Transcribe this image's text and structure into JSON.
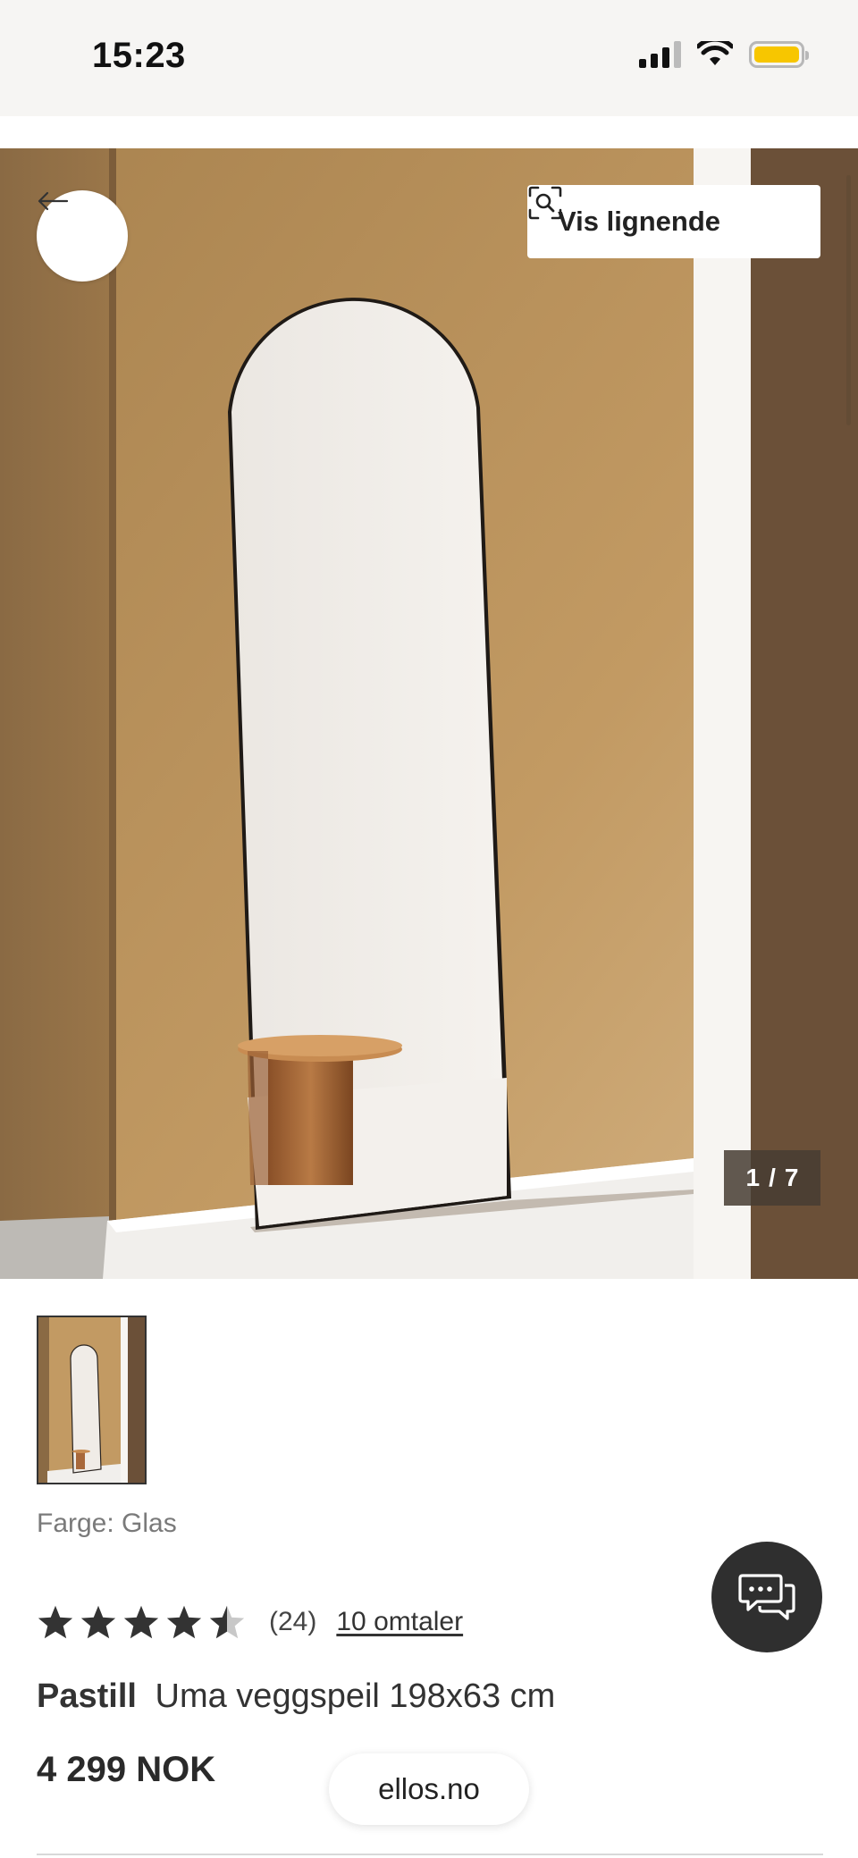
{
  "status_bar": {
    "time": "15:23"
  },
  "hero": {
    "similar_button_label": "Vis lignende",
    "counter_current": "1",
    "counter_separator": "/",
    "counter_total": "7"
  },
  "product": {
    "color_label": "Farge: Glas",
    "rating": 4.5,
    "rating_max": 5,
    "rating_count": "(24)",
    "reviews_link": "10 omtaler",
    "brand": "Pastill",
    "name": "Uma veggspeil 198x63 cm",
    "price": "4 299 NOK"
  },
  "browser": {
    "site": "ellos.no"
  },
  "colors": {
    "accent_dark": "#2f2f2f",
    "battery": "#f7c600",
    "wall": "#c39a62"
  }
}
